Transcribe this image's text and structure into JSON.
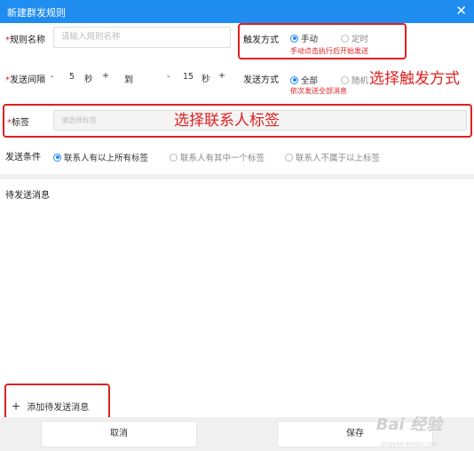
{
  "window": {
    "title": "新建群发规则",
    "close_glyph": "✕"
  },
  "rule_name": {
    "label": "规则名称",
    "required_mark": "*",
    "placeholder": "请输入规则名称"
  },
  "trigger": {
    "label": "触发方式",
    "options": [
      {
        "label": "手动",
        "selected": true
      },
      {
        "label": "定时",
        "selected": false
      }
    ],
    "hint": "手动点击执行后开始发送"
  },
  "interval": {
    "label": "发送间隔",
    "required_mark": "*",
    "minus": "-",
    "plus": "+",
    "from_value": "5",
    "to_label": "到",
    "to_value": "15",
    "unit": "秒"
  },
  "send_mode": {
    "label": "发送方式",
    "options": [
      {
        "label": "全部",
        "selected": true
      },
      {
        "label": "随机",
        "selected": false
      }
    ],
    "hint": "依次发送全部消息"
  },
  "tag": {
    "label": "标签",
    "required_mark": "*",
    "placeholder": "请选择标签"
  },
  "condition": {
    "label": "发送条件",
    "options": [
      {
        "label": "联系人有以上所有标签",
        "selected": true
      },
      {
        "label": "联系人有其中一个标签",
        "selected": false
      },
      {
        "label": "联系人不属于以上标签",
        "selected": false
      }
    ]
  },
  "pending": {
    "label": "待发送消息",
    "add_icon": "+",
    "add_label": "添加待发送消息"
  },
  "footer": {
    "cancel": "取消",
    "save": "保存"
  },
  "annotations": {
    "trigger": "选择触发方式",
    "tag": "选择联系人标签"
  },
  "watermark": {
    "text": "Bai 经验",
    "sub": "jingyan.baidu.com"
  },
  "colors": {
    "accent": "#1f8cf0",
    "annotation": "#e0201f"
  }
}
